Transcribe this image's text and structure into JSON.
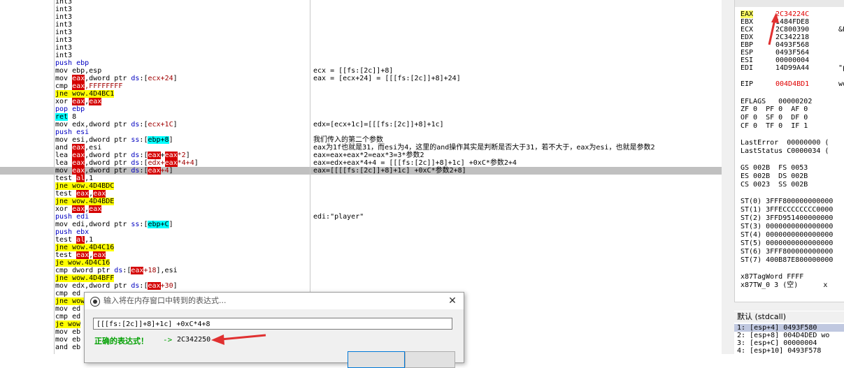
{
  "disasm": [
    {
      "seg": [
        [
          "int3",
          ""
        ]
      ],
      "cmt": ""
    },
    {
      "seg": [
        [
          "int3",
          ""
        ]
      ],
      "cmt": ""
    },
    {
      "seg": [
        [
          "int3",
          ""
        ]
      ],
      "cmt": ""
    },
    {
      "seg": [
        [
          "int3",
          ""
        ]
      ],
      "cmt": ""
    },
    {
      "seg": [
        [
          "int3",
          ""
        ]
      ],
      "cmt": ""
    },
    {
      "seg": [
        [
          "int3",
          ""
        ]
      ],
      "cmt": ""
    },
    {
      "seg": [
        [
          "int3",
          ""
        ]
      ],
      "cmt": ""
    },
    {
      "seg": [
        [
          "int3",
          ""
        ]
      ],
      "cmt": ""
    },
    {
      "seg": [
        [
          "push ebp",
          "blue"
        ]
      ],
      "cmt": ""
    },
    {
      "seg": [
        [
          "mov ebp,esp",
          ""
        ]
      ],
      "cmt": "ecx = [[fs:[2c]]+8]"
    },
    {
      "seg": [
        [
          "mov ",
          ""
        ],
        [
          "eax",
          "reg"
        ],
        [
          ",dword ptr ",
          ""
        ],
        [
          "ds",
          "blue"
        ],
        [
          ":[",
          ""
        ],
        [
          "ecx+24",
          "red"
        ],
        [
          "]",
          ""
        ]
      ],
      "cmt": "eax = [ecx+24] = [[[fs:[2c]]+8]+24]"
    },
    {
      "seg": [
        [
          "cmp ",
          ""
        ],
        [
          "eax",
          "reg"
        ],
        [
          ",FFFFFFFF",
          "red"
        ]
      ],
      "cmt": ""
    },
    {
      "seg": [
        [
          "jne wow.4D4BC1",
          "jmp"
        ]
      ],
      "cmt": ""
    },
    {
      "seg": [
        [
          "xor ",
          ""
        ],
        [
          "eax",
          "reg"
        ],
        [
          ",",
          ""
        ],
        [
          "eax",
          "reg"
        ]
      ],
      "cmt": ""
    },
    {
      "seg": [
        [
          "pop ebp",
          "blue"
        ]
      ],
      "cmt": ""
    },
    {
      "seg": [
        [
          "ret",
          "cyn"
        ],
        [
          " 8",
          ""
        ]
      ],
      "cmt": ""
    },
    {
      "seg": [
        [
          "mov edx,dword ptr ",
          ""
        ],
        [
          "ds",
          "blue"
        ],
        [
          ":[",
          ""
        ],
        [
          "ecx+1C",
          "red"
        ],
        [
          "]",
          ""
        ]
      ],
      "cmt": "edx=[ecx+1c]=[[[fs:[2c]]+8]+1c]"
    },
    {
      "seg": [
        [
          "push esi",
          "blue"
        ]
      ],
      "cmt": ""
    },
    {
      "seg": [
        [
          "mov esi,dword ptr ",
          ""
        ],
        [
          "ss",
          "blue"
        ],
        [
          ":[",
          ""
        ],
        [
          "ebp+8",
          "cyn"
        ],
        [
          "]",
          ""
        ]
      ],
      "cmt": "我们传入的第二个参数"
    },
    {
      "seg": [
        [
          "and ",
          ""
        ],
        [
          "eax",
          "reg"
        ],
        [
          ",esi",
          ""
        ]
      ],
      "cmt": "eax为1f也就是31，而esi为4，这里的and操作其实是判断是否大于31，若不大于，eax为esi，也就是参数2"
    },
    {
      "seg": [
        [
          "lea ",
          ""
        ],
        [
          "eax",
          "reg"
        ],
        [
          ",dword ptr ",
          ""
        ],
        [
          "ds",
          "blue"
        ],
        [
          ":[",
          ""
        ],
        [
          "eax",
          "reg"
        ],
        [
          "+",
          ""
        ],
        [
          "eax",
          "reg"
        ],
        [
          "*2",
          "red"
        ],
        [
          "]",
          ""
        ]
      ],
      "cmt": "eax=eax+eax*2=eax*3=3*参数2"
    },
    {
      "seg": [
        [
          "lea ",
          ""
        ],
        [
          "eax",
          "reg"
        ],
        [
          ",dword ptr ",
          ""
        ],
        [
          "ds",
          "blue"
        ],
        [
          ":[",
          ""
        ],
        [
          "edx+",
          "red"
        ],
        [
          "eax",
          "reg"
        ],
        [
          "*4+4",
          "red"
        ],
        [
          "]",
          ""
        ]
      ],
      "cmt": "eax=edx+eax*4+4 = [[[fs:[2c]]+8]+1c] +0xC*参数2+4"
    },
    {
      "seg": [
        [
          "mov ",
          ""
        ],
        [
          "eax",
          "reg"
        ],
        [
          ",dword ptr ",
          ""
        ],
        [
          "ds",
          "blue"
        ],
        [
          ":[",
          ""
        ],
        [
          "eax",
          "reg"
        ],
        [
          "+4",
          "red"
        ],
        [
          "]",
          ""
        ]
      ],
      "cmt": "eax=[[[[fs:[2c]]+8]+1c] +0xC*参数2+8]",
      "sel": true
    },
    {
      "seg": [
        [
          "test ",
          ""
        ],
        [
          "al",
          "reg"
        ],
        [
          ",1",
          ""
        ]
      ],
      "cmt": ""
    },
    {
      "seg": [
        [
          "jne wow.4D4BDC",
          "jmp"
        ]
      ],
      "cmt": ""
    },
    {
      "seg": [
        [
          "test ",
          ""
        ],
        [
          "eax",
          "reg"
        ],
        [
          ",",
          ""
        ],
        [
          "eax",
          "reg"
        ]
      ],
      "cmt": ""
    },
    {
      "seg": [
        [
          "jne wow.4D4BDE",
          "jmp"
        ]
      ],
      "cmt": ""
    },
    {
      "seg": [
        [
          "xor ",
          ""
        ],
        [
          "eax",
          "reg"
        ],
        [
          ",",
          ""
        ],
        [
          "eax",
          "reg"
        ]
      ],
      "cmt": ""
    },
    {
      "seg": [
        [
          "push edi",
          "blue"
        ]
      ],
      "cmt": "edi:\"player\""
    },
    {
      "seg": [
        [
          "mov edi,dword ptr ",
          ""
        ],
        [
          "ss",
          "blue"
        ],
        [
          ":[",
          ""
        ],
        [
          "ebp+C",
          "cyn"
        ],
        [
          "]",
          ""
        ]
      ],
      "cmt": ""
    },
    {
      "seg": [
        [
          "push ebx",
          "blue"
        ]
      ],
      "cmt": ""
    },
    {
      "seg": [
        [
          "test ",
          ""
        ],
        [
          "al",
          "reg"
        ],
        [
          ",1",
          ""
        ]
      ],
      "cmt": ""
    },
    {
      "seg": [
        [
          "jne wow.4D4C16",
          "jmp"
        ]
      ],
      "cmt": ""
    },
    {
      "seg": [
        [
          "test ",
          ""
        ],
        [
          "eax",
          "reg"
        ],
        [
          ",",
          ""
        ],
        [
          "eax",
          "reg"
        ]
      ],
      "cmt": ""
    },
    {
      "seg": [
        [
          "je wow.4D4C16",
          "jmp"
        ]
      ],
      "cmt": ""
    },
    {
      "seg": [
        [
          "cmp dword ptr ",
          ""
        ],
        [
          "ds",
          "blue"
        ],
        [
          ":[",
          ""
        ],
        [
          "eax",
          "reg"
        ],
        [
          "+18",
          "red"
        ],
        [
          "],esi",
          ""
        ]
      ],
      "cmt": ""
    },
    {
      "seg": [
        [
          "jne wow.4D4BFF",
          "jmp"
        ]
      ],
      "cmt": ""
    },
    {
      "seg": [
        [
          "mov edx,dword ptr ",
          ""
        ],
        [
          "ds",
          "blue"
        ],
        [
          ":[",
          ""
        ],
        [
          "eax",
          "reg"
        ],
        [
          "+30",
          "red"
        ],
        [
          "]",
          ""
        ]
      ],
      "cmt": ""
    },
    {
      "seg": [
        [
          "cmp ed",
          ""
        ]
      ],
      "cmt": ""
    },
    {
      "seg": [
        [
          "jne wow",
          "jmp"
        ]
      ],
      "cmt": ""
    },
    {
      "seg": [
        [
          "mov ed",
          ""
        ]
      ],
      "cmt": ""
    },
    {
      "seg": [
        [
          "cmp ed",
          ""
        ]
      ],
      "cmt": ""
    },
    {
      "seg": [
        [
          "je wow",
          "jmp"
        ]
      ],
      "cmt": ""
    },
    {
      "seg": [
        [
          "mov eb",
          ""
        ]
      ],
      "cmt": ""
    },
    {
      "seg": [
        [
          "mov eb",
          ""
        ]
      ],
      "cmt": ""
    },
    {
      "seg": [
        [
          "and eb",
          ""
        ]
      ],
      "cmt": ""
    }
  ],
  "registers": [
    {
      "name": "EAX",
      "value": "2C34224C",
      "extra": "",
      "red": true
    },
    {
      "name": "EBX",
      "value": "1484FDE8",
      "extra": "",
      "red": false
    },
    {
      "name": "ECX",
      "value": "2C800390",
      "extra": "&L'",
      "red": false
    },
    {
      "name": "EDX",
      "value": "2C342218",
      "extra": "",
      "red": false
    },
    {
      "name": "EBP",
      "value": "0493F568",
      "extra": "",
      "red": false
    },
    {
      "name": "ESP",
      "value": "0493F564",
      "extra": "",
      "red": false
    },
    {
      "name": "ESI",
      "value": "00000004",
      "extra": "",
      "red": false
    },
    {
      "name": "EDI",
      "value": "14D99A44",
      "extra": "\"pl",
      "red": false
    },
    {
      "name": "EIP",
      "value": "004D4BD1",
      "extra": "wow",
      "red": true
    }
  ],
  "flags": {
    "eflags": "EFLAGS   00000202",
    "rows": [
      "ZF 0  PF 0  AF 0",
      "OF 0  SF 0  DF 0",
      "CF 0  TF 0  IF 1"
    ]
  },
  "errors": [
    "LastError  00000000 (",
    "LastStatus C0000034 ("
  ],
  "segments": [
    "GS 002B  FS 0053",
    "ES 002B  DS 002B",
    "CS 0023  SS 002B"
  ],
  "fpu": [
    "ST(0) 3FFF800000000000",
    "ST(1) 3FFECCCCCCCC0000",
    "ST(2) 3FFD951400000000",
    "ST(3) 0000000000000000",
    "ST(4) 0000000000000000",
    "ST(5) 0000000000000000",
    "ST(6) 3FFF800000000000",
    "ST(7) 400B87E800000000"
  ],
  "x87": [
    "x87TagWord FFFF",
    "x87TW_0 3 (空)      x"
  ],
  "callstack": {
    "header": "默认 (stdcall)",
    "rows": [
      "1: [esp+4] 0493F580",
      "2: [esp+8] 004D4DED wo",
      "3: [esp+C] 00000004",
      "4: [esp+10] 0493F578"
    ]
  },
  "dialog": {
    "title": "输入将在内存窗口中转到的表达式...",
    "close": "✕",
    "input_value": "[[[fs:[2c]]+8]+1c] +0xC*4+8",
    "ok_label": "正确的表达式！",
    "arrow": "->",
    "result": "2C342250"
  },
  "annotation_color": "#e03030"
}
